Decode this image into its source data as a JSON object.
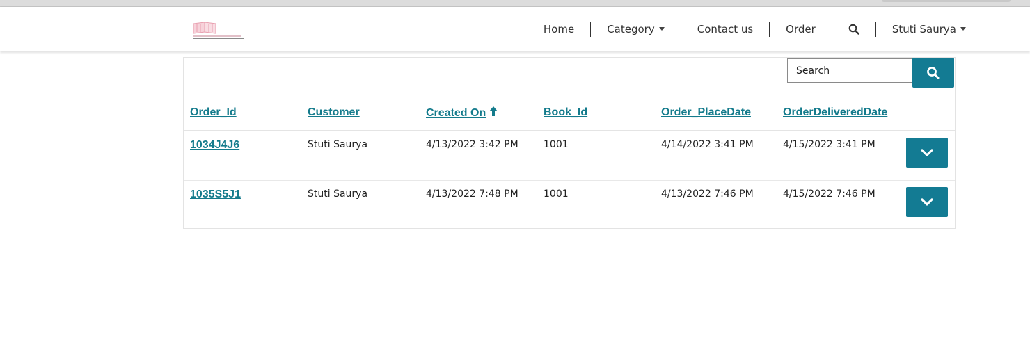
{
  "nav": {
    "logo_text": "BOOKSTORE",
    "items": [
      {
        "label": "Home"
      },
      {
        "label": "Category",
        "dropdown": true
      },
      {
        "label": "Contact us"
      },
      {
        "label": "Order"
      },
      {
        "label": "",
        "icon": "search-icon"
      },
      {
        "label": "Stuti Saurya",
        "dropdown": true
      }
    ]
  },
  "search": {
    "placeholder": "Search",
    "value": "",
    "button_icon": "search-icon"
  },
  "table": {
    "columns": [
      "Order_Id",
      "Customer",
      "Created On",
      "Book_Id",
      "Order_PlaceDate",
      "OrderDeliveredDate"
    ],
    "sorted_column": "Created On",
    "sort_direction": "ascending",
    "rows": [
      {
        "order_id": "1034J4J6",
        "customer": "Stuti Saurya",
        "created_on": "4/13/2022 3:42 PM",
        "book_id": "1001",
        "order_place_date": "4/14/2022 3:41 PM",
        "order_delivered_date": "4/15/2022 3:41 PM"
      },
      {
        "order_id": "1035S5J1",
        "customer": "Stuti Saurya",
        "created_on": "4/13/2022 7:48 PM",
        "book_id": "1001",
        "order_place_date": "4/13/2022 7:46 PM",
        "order_delivered_date": "4/15/2022 7:46 PM"
      }
    ]
  },
  "colors": {
    "accent": "#137b93",
    "link": "#147b8c"
  }
}
